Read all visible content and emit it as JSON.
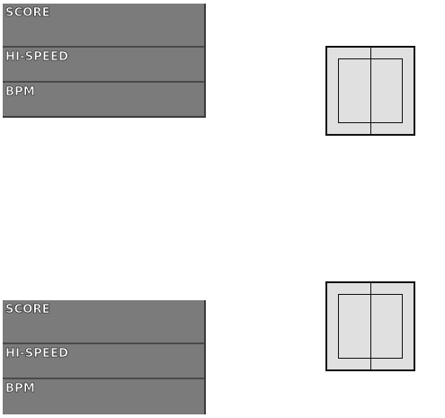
{
  "panels": [
    {
      "score_label": "SCORE",
      "hispeed_label": "HI-SPEED",
      "bpm_label": "BPM"
    },
    {
      "score_label": "SCORE",
      "hispeed_label": "HI-SPEED",
      "bpm_label": "BPM"
    }
  ],
  "colors": {
    "panel_fill": "#7b7b7b",
    "panel_divider": "#4a4a4a",
    "widget_fill": "#e0e0e0",
    "widget_line": "#111111",
    "label_text": "#ffffff"
  },
  "icons": {
    "lane_widget": "lane-box-icon"
  }
}
